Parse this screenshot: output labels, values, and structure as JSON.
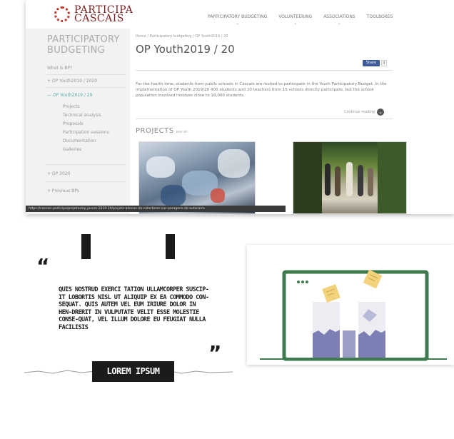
{
  "screenshot": {
    "logo": {
      "line1": "PARTICIPA",
      "line2": "CASCAIS"
    },
    "nav": [
      {
        "label": "PARTICIPATORY BUDGETING"
      },
      {
        "label": "VOLUNTEERING"
      },
      {
        "label": "ASSOCIATIONS"
      },
      {
        "label": "TOOLBOXES"
      }
    ],
    "sidebar": {
      "title": "PARTICIPATORY BUDGETING",
      "items": [
        {
          "label": "What is BP?"
        },
        {
          "label": "+ OP Youth2019 / 2020"
        },
        {
          "label": "— OP Youth2019 / 20"
        },
        {
          "label": "+ OP 2020"
        },
        {
          "label": "+ Previous BPs"
        }
      ],
      "subitems": [
        {
          "label": "Projects"
        },
        {
          "label": "Technical analysis"
        },
        {
          "label": "Proposals"
        },
        {
          "label": "Participation sessions"
        },
        {
          "label": "Documentation"
        },
        {
          "label": "Galleries"
        }
      ]
    },
    "breadcrumb": "Home / Participatory budgeting / OP Youth2019 / 20",
    "page_title": "OP Youth2019 / 20",
    "share_label": "Share",
    "share_count": "0",
    "intro_text": "For the fourth time, students from public schools in Cascais are invited to participate in the Youth Participatory Budget. In the implementation of OP Youth 2019/20 400 students and 20 teachers from 15 schools directly participate, but the school population involved involves close to 16,000 students.",
    "continue_label": "Continue reading",
    "projects_heading": "PROJECTS",
    "projects_see_all": "see all",
    "status_url": "https://cascais.participa/projetos/op-jovem-2019-20/projeto-adesao-de-colectores-nas-paragens-de-autocarro"
  },
  "quote": {
    "text": "QUIS NOSTRUD EXERCI TATION ULLAMCORPER SUSCIP-IT LOBORTIS NISL UT ALIQUIP EX EA COMMODO CON-SEQUAT. QUIS AUTEM VEL EUM IRIURE DOLOR IN HEN-DRERIT IN VULPUTATE VELIT ESSE MOLESTIE CONSE-QUAT, VEL ILLUM DOLORE EU FEUGIAT NULLA FACILISIS",
    "open_mark": "“",
    "close_mark": "”",
    "button_label": "LOREM IPSUM"
  },
  "colors": {
    "laptop_frame": "#3e7a4e",
    "bars": "#7b7fb4",
    "sticky_note": "#f2d27a",
    "grass": "#3e7a4e"
  }
}
